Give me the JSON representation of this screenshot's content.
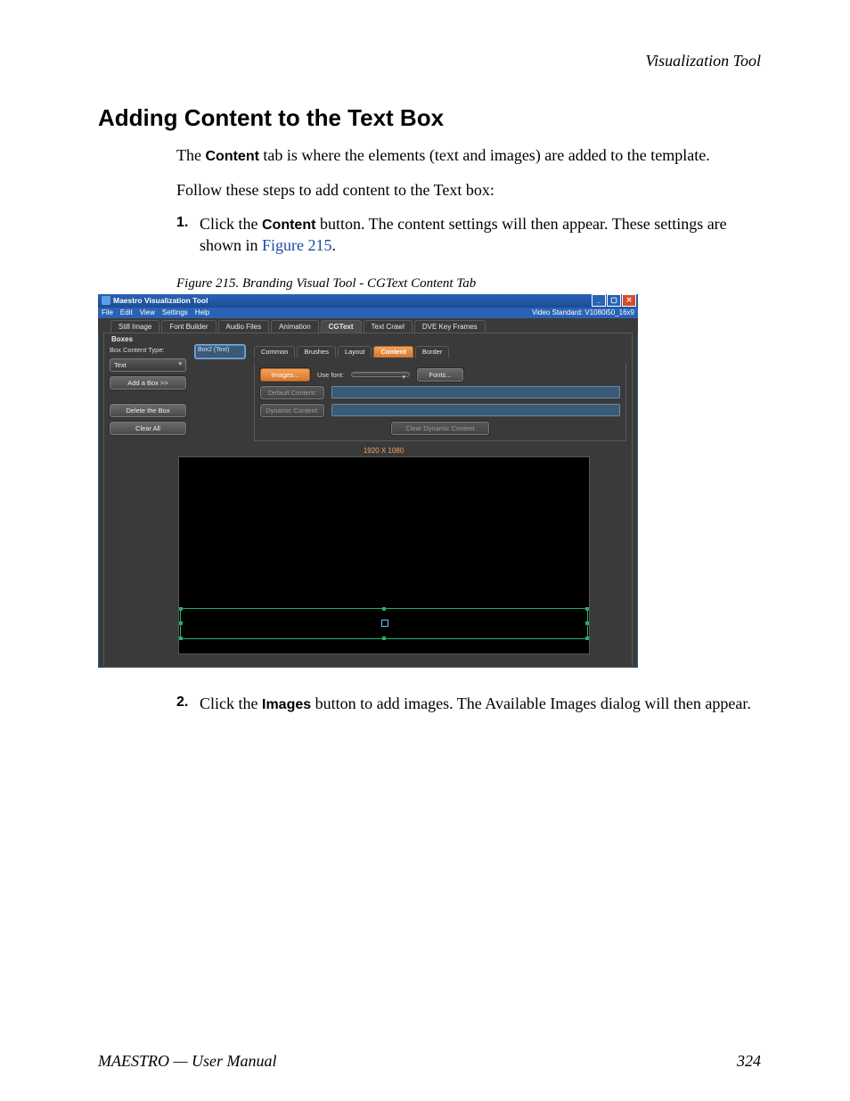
{
  "running_head": "Visualization Tool",
  "section_title": "Adding Content to the Text Box",
  "intro": {
    "p1_a": "The ",
    "p1_bold": "Content",
    "p1_b": " tab is where the elements (text and images) are added to the template.",
    "p2": "Follow these steps to add content to the Text box:"
  },
  "steps": {
    "s1_num": "1.",
    "s1_a": "Click the ",
    "s1_bold": "Content",
    "s1_b": " button. The content settings will then appear. These settings are shown in ",
    "s1_link": "Figure 215",
    "s1_c": ".",
    "s2_num": "2.",
    "s2_a": "Click the ",
    "s2_bold": "Images",
    "s2_b": " button to add images. The Available Images dialog will then appear."
  },
  "figure_caption": "Figure 215.  Branding Visual Tool - CGText Content Tab",
  "app": {
    "title": "Maestro Visualization Tool",
    "video_standard": "Video Standard: V1080i50_16x9",
    "menu": {
      "file": "File",
      "edit": "Edit",
      "view": "View",
      "settings": "Settings",
      "help": "Help"
    },
    "tabs": {
      "still_image": "Still Image",
      "font_builder": "Font Builder",
      "audio_files": "Audio Files",
      "animation": "Animation",
      "cgtext": "CGText",
      "text_crawl": "Text Crawl",
      "dve_key_frames": "DVE Key Frames"
    },
    "boxes": {
      "panel_title": "Boxes",
      "box_content_type_label": "Box Content Type:",
      "box_content_type_value": "Box2 (Text)",
      "text_dropdown": "Text",
      "add_box": "Add a Box >>",
      "delete_box": "Delete the Box",
      "clear_all": "Clear All"
    },
    "sub_tabs": {
      "common": "Common",
      "brushes": "Brushes",
      "layout": "Layout",
      "content": "Content",
      "border": "Border"
    },
    "content_panel": {
      "images": "Images...",
      "use_font_label": "Use font:",
      "fonts": "Fonts...",
      "default_content": "Default Content:",
      "dynamic_content": "Dynamic Content:",
      "clear_dynamic": "Clear Dynamic Content"
    },
    "canvas_label": "1920 X 1080"
  },
  "footer": {
    "doc": "MAESTRO  —  User Manual",
    "page": "324"
  }
}
